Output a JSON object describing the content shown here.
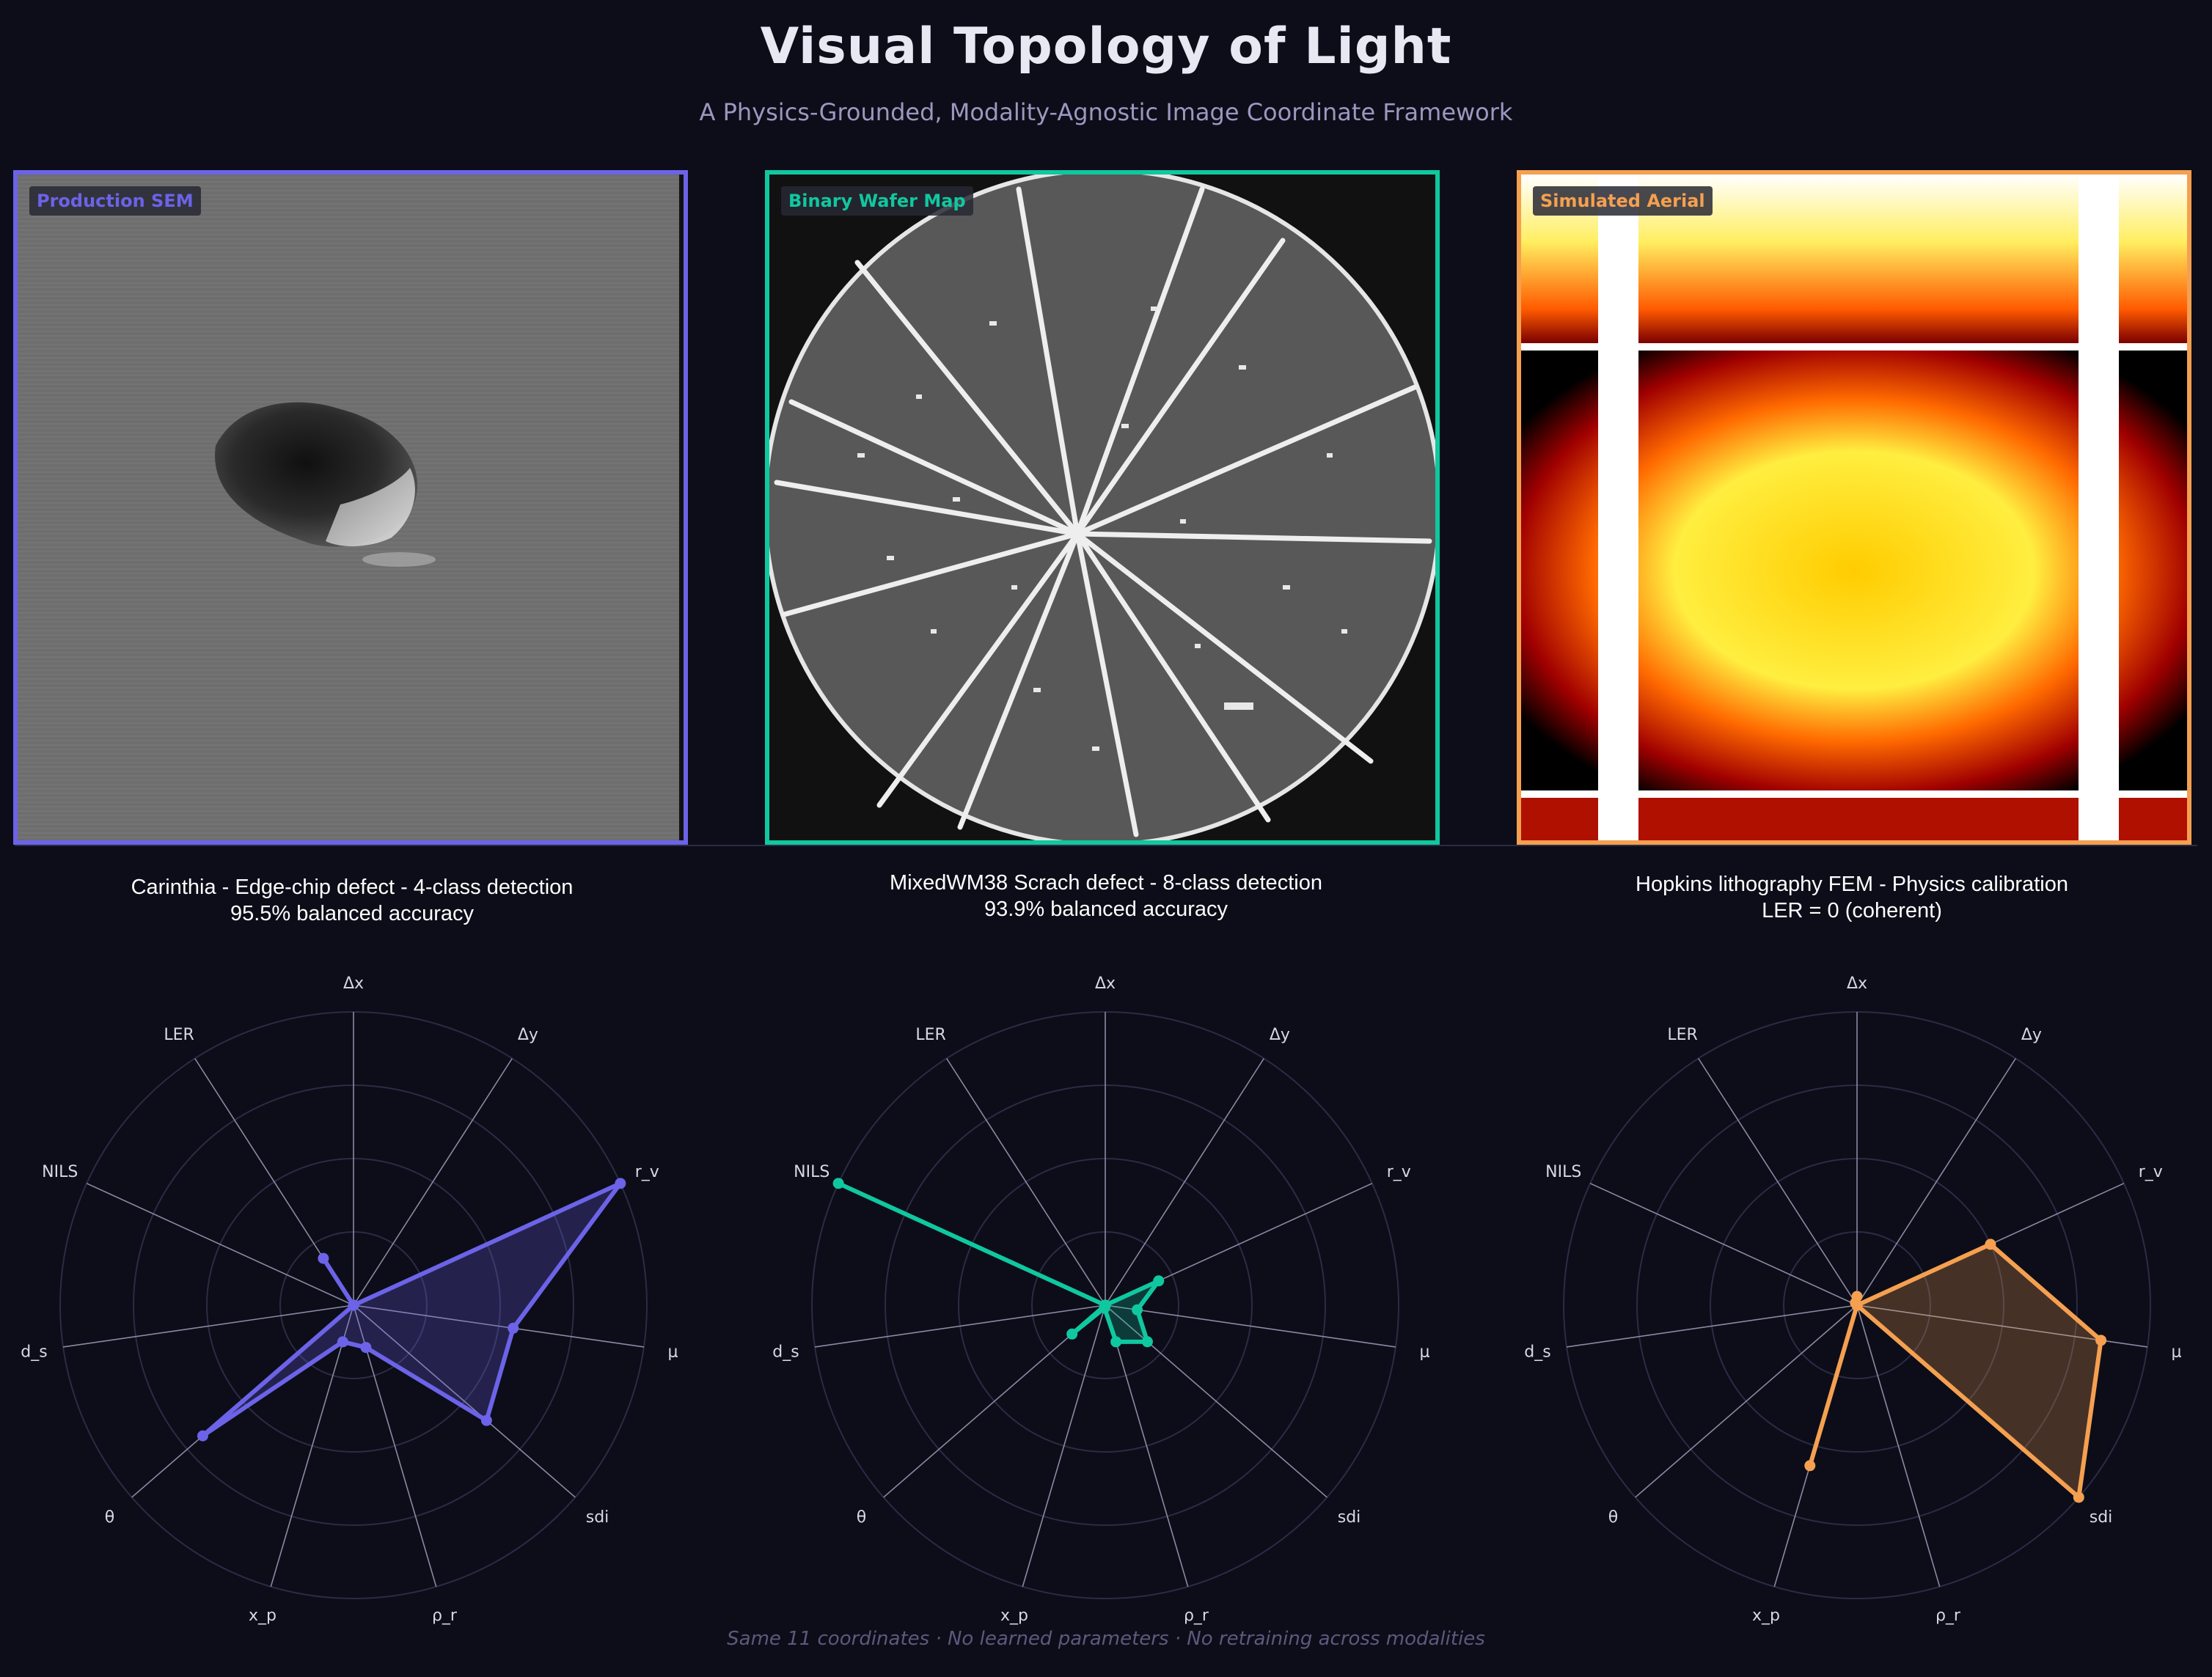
{
  "title": "Visual Topology of Light",
  "subtitle": "A Physics-Grounded, Modality-Agnostic Image Coordinate Framework",
  "footer": "Same 11 coordinates · No learned parameters · No retraining across modalities",
  "panels": [
    {
      "tag": "Production SEM",
      "color": "#6c63e8",
      "caption_line1": "Carinthia - Edge-chip defect - 4-class detection",
      "caption_line2": "95.5% balanced accuracy"
    },
    {
      "tag": "Binary Wafer Map",
      "color": "#10c8a0",
      "caption_line1": "MixedWM38 Scrach defect - 8-class detection",
      "caption_line2": "93.9% balanced accuracy"
    },
    {
      "tag": "Simulated Aerial",
      "color": "#f5a050",
      "caption_line1": "Hopkins lithography FEM - Physics calibration",
      "caption_line2": "LER = 0 (coherent)"
    }
  ],
  "chart_data": [
    {
      "type": "radar",
      "axes": [
        "Δx",
        "Δy",
        "r_v",
        "μ",
        "sdi",
        "ρ_r",
        "x_p",
        "θ",
        "d_s",
        "NILS",
        "LER"
      ],
      "values": [
        0.0,
        0.0,
        1.0,
        0.55,
        0.6,
        0.15,
        0.13,
        0.68,
        0.0,
        0.0,
        0.19
      ],
      "ylim": [
        0,
        1
      ],
      "color": "#6c63e8",
      "grid": true
    },
    {
      "type": "radar",
      "axes": [
        "Δx",
        "Δy",
        "r_v",
        "μ",
        "sdi",
        "ρ_r",
        "x_p",
        "θ",
        "d_s",
        "NILS",
        "LER"
      ],
      "values": [
        0.0,
        0.0,
        0.2,
        0.11,
        0.19,
        0.13,
        0.01,
        0.15,
        0.0,
        1.0,
        0.0
      ],
      "ylim": [
        0,
        1
      ],
      "color": "#10c8a0",
      "grid": true
    },
    {
      "type": "radar",
      "axes": [
        "Δx",
        "Δy",
        "r_v",
        "μ",
        "sdi",
        "ρ_r",
        "x_p",
        "θ",
        "d_s",
        "NILS",
        "LER"
      ],
      "values": [
        0.03,
        0.0,
        0.5,
        0.84,
        1.0,
        0.0,
        0.57,
        0.0,
        0.0,
        0.0,
        0.01
      ],
      "ylim": [
        0,
        1
      ],
      "color": "#f5a050",
      "grid": true
    }
  ]
}
